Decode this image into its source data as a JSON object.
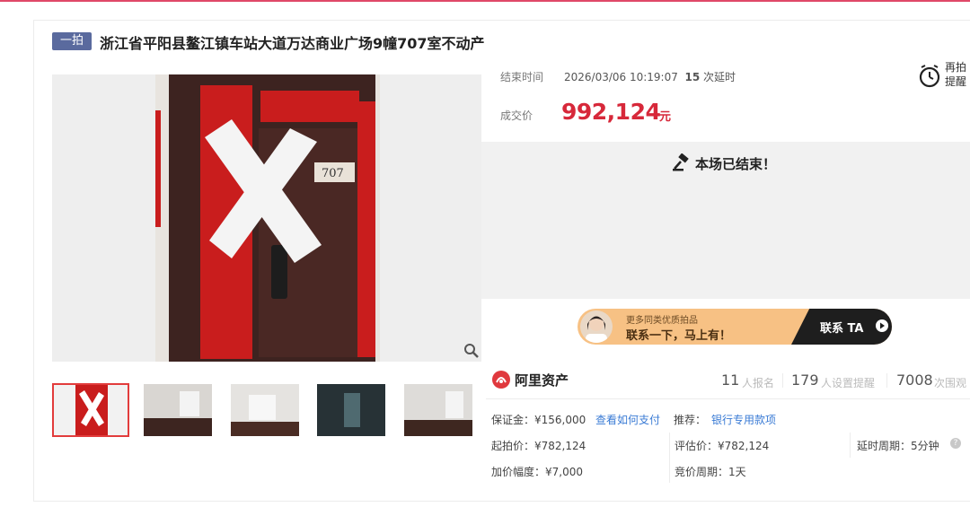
{
  "header": {
    "tag": "一拍",
    "title": "浙江省平阳县鳌江镇车站大道万达商业广场9幢707室不动产"
  },
  "gallery": {
    "main_door_number": "707",
    "thumbnails": [
      "封条门",
      "客厅",
      "房间",
      "走廊",
      "房间2"
    ]
  },
  "auction": {
    "end_time_label": "结束时间",
    "end_time_value": "2026/03/06 10:19:07",
    "extensions_count": "15",
    "extensions_label": "次延时",
    "deal_price_label": "成交价",
    "deal_price": "992,124",
    "currency_unit": "元",
    "remind_label_1": "再拍",
    "remind_label_2": "提醒",
    "ended_message": "本场已结束！"
  },
  "banner": {
    "line1": "更多同类优质拍品",
    "line2": "联系一下，马上有！",
    "cta": "联系 TA"
  },
  "platform": {
    "name": "阿里资产",
    "stats": [
      {
        "num": "11",
        "label": "人报名"
      },
      {
        "num": "179",
        "label": "人设置提醒"
      },
      {
        "num": "7008",
        "label": "次围观"
      }
    ]
  },
  "details": {
    "deposit": "保证金：¥156,000",
    "how_to_pay": "查看如何支付",
    "recommend_label": "推荐：",
    "recommend_value": "银行专用款项",
    "start_price": "起拍价：¥782,124",
    "appraisal": "评估价：¥782,124",
    "delay_period": "延时周期：5分钟",
    "increment": "加价幅度：¥7,000",
    "bid_period": "竞价周期：1天"
  },
  "colors": {
    "accent_red": "#d7283a",
    "tag_bg": "#5a6a9e",
    "link_blue": "#3a7bd5"
  }
}
